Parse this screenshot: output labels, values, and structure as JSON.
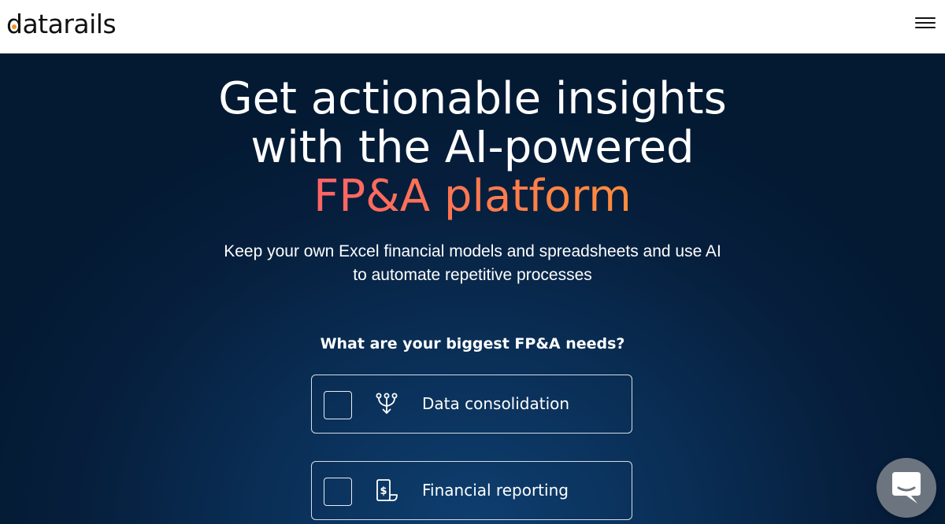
{
  "header": {
    "logo_text": "datarails",
    "menu_icon": "hamburger-menu-icon"
  },
  "hero": {
    "headline_line1": "Get actionable insights",
    "headline_line2": "with the AI-powered",
    "headline_highlight": "FP&A platform",
    "subtitle_line1": "Keep your own Excel financial models and spreadsheets and use AI",
    "subtitle_line2": "to automate repetitive processes",
    "question": "What are your biggest FP&A needs?",
    "options": [
      {
        "label": "Data consolidation",
        "icon": "data-merge-icon",
        "checked": false
      },
      {
        "label": "Financial reporting",
        "icon": "financial-report-icon",
        "checked": false
      }
    ]
  },
  "chat": {
    "icon": "chat-bubble-icon"
  },
  "colors": {
    "hero_bg": "#041a33",
    "accent_pink": "#ff3d7f",
    "accent_orange": "#ffa52b",
    "logo_orange": "#f7941d"
  }
}
